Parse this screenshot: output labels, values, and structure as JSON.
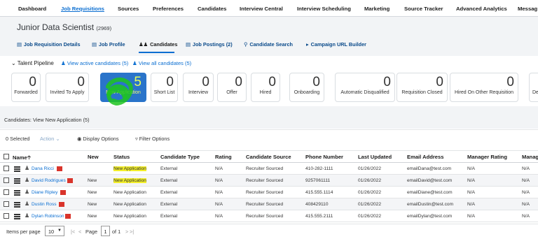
{
  "top_nav": [
    "Dashboard",
    "Job Requisitions",
    "Sources",
    "Preferences",
    "Candidates",
    "Interview Central",
    "Interview Scheduling",
    "Marketing",
    "Source Tracker",
    "Advanced Analytics",
    "Messag"
  ],
  "job": {
    "title": "Junior Data Scientist",
    "id": "(2969)"
  },
  "tabs": [
    "Job Requisition Details",
    "Job Profile",
    "Candidates",
    "Job Postings (2)",
    "Candidate Search",
    "Campaign URL Builder"
  ],
  "pipeline": {
    "label": "Talent Pipeline",
    "active_link": "View active candidates (5)",
    "all_link": "View all candidates (5)",
    "stages": [
      {
        "count": "0",
        "label": "Forwarded"
      },
      {
        "count": "0",
        "label": "Invited To Apply"
      },
      {
        "count": "5",
        "label": "New Application"
      },
      {
        "count": "0",
        "label": "Short List"
      },
      {
        "count": "0",
        "label": "Interview"
      },
      {
        "count": "0",
        "label": "Offer"
      },
      {
        "count": "0",
        "label": "Hired"
      },
      {
        "count": "0",
        "label": "Onboarding"
      },
      {
        "count": "0",
        "label": "Automatic Disqualified"
      },
      {
        "count": "0",
        "label": "Requisition Closed"
      },
      {
        "count": "0",
        "label": "Hired On Other Requisition"
      },
      {
        "count": "",
        "label": "De"
      }
    ]
  },
  "candidates_label": "Candidates: View New Application (5)",
  "toolbar": {
    "selected": "0 Selected",
    "action": "Action",
    "display": "Display Options",
    "filter": "Filter Options"
  },
  "columns": [
    "Name",
    "New",
    "Status",
    "Candidate Type",
    "Rating",
    "Candidate Source",
    "Phone Number",
    "Last Updated",
    "Email Address",
    "Manager Rating",
    "Manag"
  ],
  "rows": [
    {
      "name": "Dana Ricci",
      "new": "",
      "status": "New Application",
      "type": "External",
      "rating": "N/A",
      "source": "Recruiter Sourced",
      "phone": "410-282-1111",
      "updated": "01/26/2022",
      "email": "emailDana@test.com",
      "mgr_rating": "N/A",
      "mgr": "N/A"
    },
    {
      "name": "David Rodrigues",
      "new": "New",
      "status": "New Application",
      "type": "External",
      "rating": "N/A",
      "source": "Recruiter Sourced",
      "phone": "9257061111",
      "updated": "01/26/2022",
      "email": "emailDavid@test.com",
      "mgr_rating": "N/A",
      "mgr": "N/A"
    },
    {
      "name": "Diane Ripley",
      "new": "New",
      "status": "New Application",
      "type": "External",
      "rating": "N/A",
      "source": "Recruiter Sourced",
      "phone": "415.555.1114",
      "updated": "01/26/2022",
      "email": "emailDiane@test.com",
      "mgr_rating": "N/A",
      "mgr": "N/A"
    },
    {
      "name": "Dustin Ross",
      "new": "New",
      "status": "New Application",
      "type": "External",
      "rating": "N/A",
      "source": "Recruiter Sourced",
      "phone": "408429110",
      "updated": "01/26/2022",
      "email": "emailDustin@test.com",
      "mgr_rating": "N/A",
      "mgr": "N/A"
    },
    {
      "name": "Dylan Robinson",
      "new": "New",
      "status": "New Application",
      "type": "External",
      "rating": "N/A",
      "source": "Recruiter Sourced",
      "phone": "415.555.2111",
      "updated": "01/26/2022",
      "email": "emailDylan@test.com",
      "mgr_rating": "N/A",
      "mgr": "N/A"
    }
  ],
  "footer": {
    "items_per_page": "Items per page",
    "per_page_value": "10",
    "page_label": "Page",
    "page_value": "1",
    "of_label": "of 1"
  },
  "colors": {
    "accent": "#0a6ed1",
    "selected_tile": "#2a74ca",
    "highlight": "#f3ef2a",
    "annotation": "#1ec41e"
  }
}
